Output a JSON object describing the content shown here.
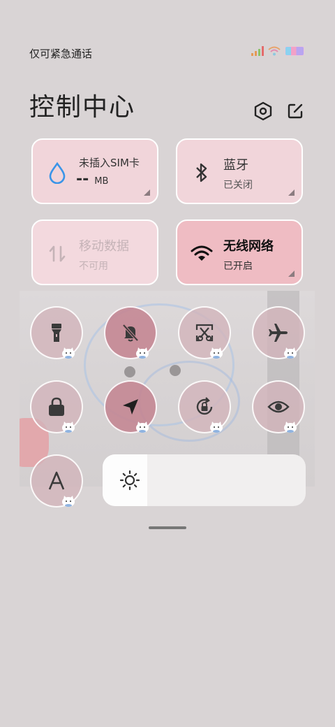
{
  "status_bar": {
    "carrier_text": "仅可紧急通话",
    "icons": [
      "signal-icon",
      "wifi-icon",
      "battery-icon"
    ]
  },
  "header": {
    "title": "控制中心",
    "settings_icon": "settings-hexagon-icon",
    "edit_icon": "edit-icon"
  },
  "tiles": {
    "data_usage": {
      "title": "未插入SIM卡",
      "value": "--",
      "unit": "MB",
      "icon": "water-drop-icon"
    },
    "bluetooth": {
      "title": "蓝牙",
      "status": "已关闭",
      "icon": "bluetooth-icon"
    },
    "mobile_data": {
      "title": "移动数据",
      "status": "不可用",
      "icon": "data-arrows-icon"
    },
    "wifi": {
      "title": "无线网络",
      "status": "已开启",
      "icon": "wifi-icon"
    }
  },
  "toggles": [
    {
      "name": "flashlight",
      "icon": "flashlight-icon",
      "on": false
    },
    {
      "name": "silent",
      "icon": "bell-off-icon",
      "on": true
    },
    {
      "name": "screenshot",
      "icon": "scissors-icon",
      "on": false
    },
    {
      "name": "airplane",
      "icon": "airplane-icon",
      "on": false
    },
    {
      "name": "lock",
      "icon": "lock-icon",
      "on": false
    },
    {
      "name": "location",
      "icon": "location-arrow-icon",
      "on": true
    },
    {
      "name": "rotation-lock",
      "icon": "rotation-lock-icon",
      "on": false
    },
    {
      "name": "eye-care",
      "icon": "eye-icon",
      "on": false
    },
    {
      "name": "font",
      "icon": "font-a-icon",
      "on": false
    }
  ],
  "brightness": {
    "level": 0.22,
    "icon": "sun-icon"
  },
  "colors": {
    "background": "#d9d4d5",
    "tile": "#f1d5da",
    "tile_active": "#efbcc3",
    "toggle_on": "#c48592",
    "accent_blue": "#3a95e8"
  }
}
